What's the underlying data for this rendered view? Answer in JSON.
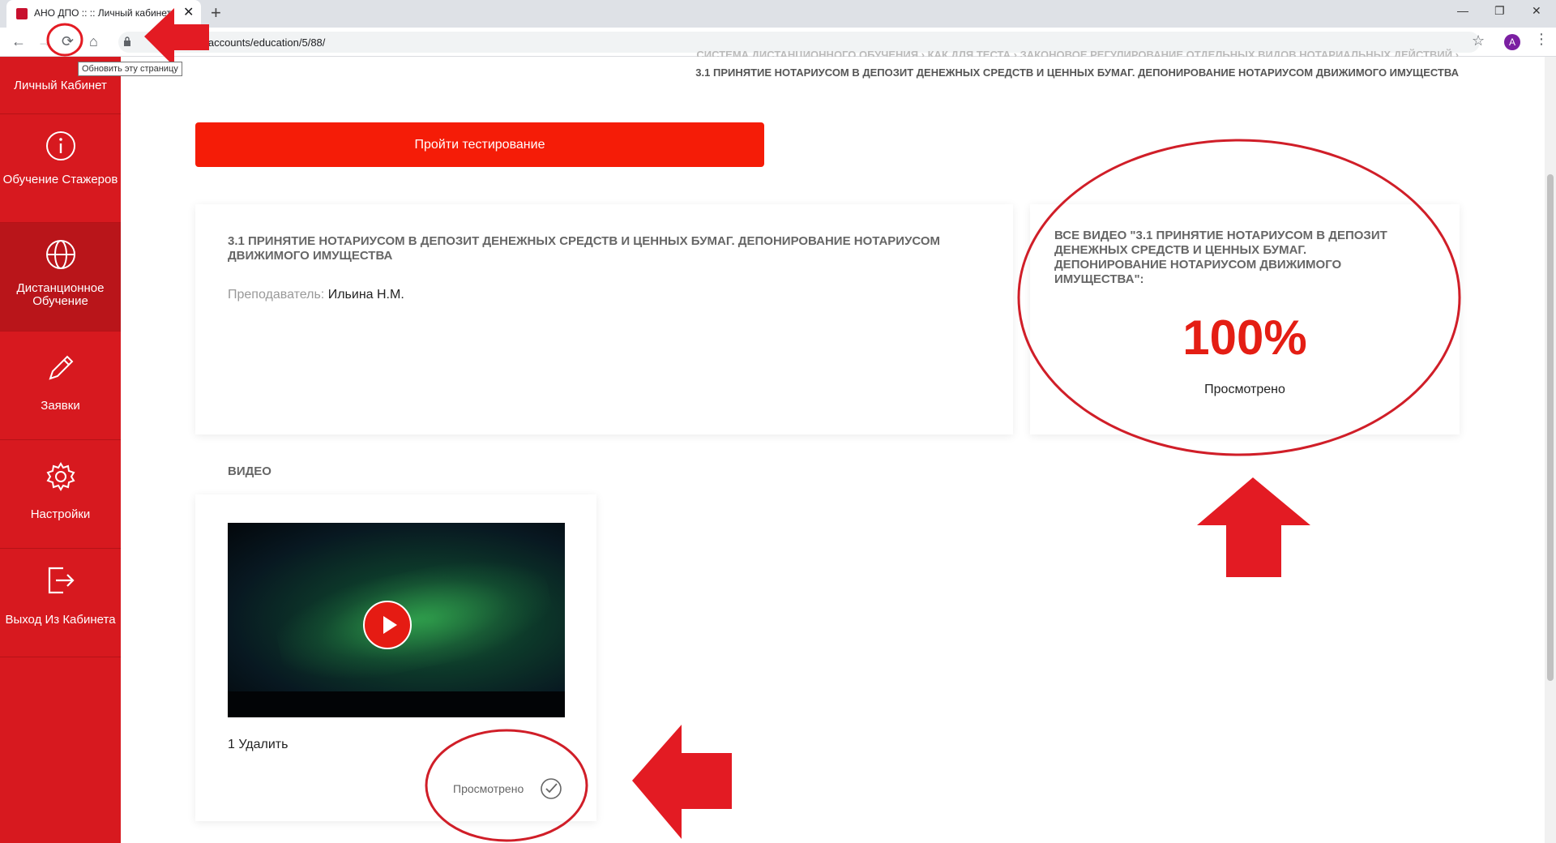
{
  "browser": {
    "tab_title": "АНО ДПО :: :: Личный кабинет",
    "url": "u/accounts/education/5/88/",
    "tooltip": "Обновить эту страницу",
    "profile_initial": "A"
  },
  "sidebar": {
    "items": [
      {
        "label": "Личный Кабинет",
        "icon": "user-icon"
      },
      {
        "label": "Обучение Стажеров",
        "icon": "info-icon"
      },
      {
        "label": "Дистанционное Обучение",
        "icon": "globe-icon"
      },
      {
        "label": "Заявки",
        "icon": "pencil-icon"
      },
      {
        "label": "Настройки",
        "icon": "gear-icon"
      },
      {
        "label": "Выход Из Кабинета",
        "icon": "logout-icon"
      }
    ]
  },
  "breadcrumb": {
    "trail": "СИСТЕМА ДИСТАНЦИОННОГО ОБУЧЕНИЯ  ›  КАК ДЛЯ ТЕСТА  ›  ЗАКОНОВОЕ РЕГУЛИРОВАНИЕ ОТДЕЛЬНЫХ ВИДОВ НОТАРИАЛЬНЫХ ДЕЙСТВИЙ  ›",
    "current": "3.1 ПРИНЯТИЕ НОТАРИУСОМ В ДЕПОЗИТ ДЕНЕЖНЫХ СРЕДСТВ И ЦЕННЫХ БУМАГ. ДЕПОНИРОВАНИЕ НОТАРИУСОМ ДВИЖИМОГО ИМУЩЕСТВА"
  },
  "test_button": "Пройти тестирование",
  "lesson": {
    "title": "3.1 ПРИНЯТИЕ НОТАРИУСОМ В ДЕПОЗИТ ДЕНЕЖНЫХ СРЕДСТВ И ЦЕННЫХ БУМАГ. ДЕПОНИРОВАНИЕ НОТАРИУСОМ ДВИЖИМОГО ИМУЩЕСТВА",
    "teacher_label": "Преподаватель:",
    "teacher_name": "Ильина Н.М."
  },
  "progress": {
    "title": "ВСЕ ВИДЕО \"3.1 ПРИНЯТИЕ НОТАРИУСОМ В ДЕПОЗИТ ДЕНЕЖНЫХ СРЕДСТВ И ЦЕННЫХ БУМАГ. ДЕПОНИРОВАНИЕ НОТАРИУСОМ ДВИЖИМОГО ИМУЩЕСТВА\":",
    "value": "100%",
    "label": "Просмотрено"
  },
  "videos": {
    "section_title": "ВИДЕО",
    "items": [
      {
        "name": "1 Удалить",
        "status": "Просмотрено"
      }
    ]
  },
  "colors": {
    "brand_red": "#d7191f",
    "button_red": "#f51c07",
    "annotation_red": "#e31b23"
  }
}
